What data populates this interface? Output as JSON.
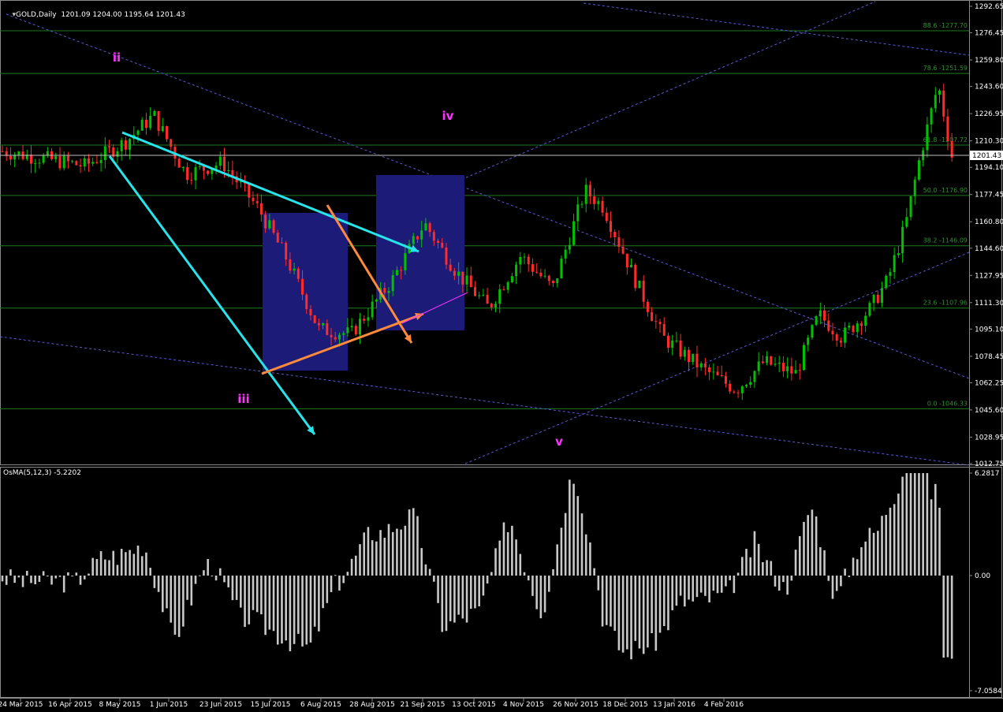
{
  "header": {
    "symbol_line": "GOLD,Daily  1201.09 1204.00 1195.64 1201.43",
    "indicator_line": "OsMA(5,12,3) -5.2202"
  },
  "colors": {
    "bull": "#00c000",
    "bear": "#ff2a2a",
    "fib": "#1f7a1f",
    "fib_text": "#2f8f2f",
    "channel": "#5a5ad8",
    "box": "#1c1c78",
    "cyan": "#27e3ea",
    "orange": "#ff8a3c",
    "wave": "#ff33ff",
    "osma": "#c8c8c8"
  },
  "chart_data": [
    {
      "type": "candlestick",
      "title": "GOLD,Daily",
      "ohlc_readout": {
        "open": 1201.09,
        "high": 1204.0,
        "low": 1195.64,
        "close": 1201.43
      },
      "ylim": [
        1012.75,
        1292.65
      ],
      "y_ticks": [
        "1292.65",
        "1276.45",
        "1259.80",
        "1243.60",
        "1226.95",
        "1210.30",
        "1194.10",
        "1177.45",
        "1160.80",
        "1144.60",
        "1127.95",
        "1111.30",
        "1095.10",
        "1078.45",
        "1062.25",
        "1045.60",
        "1028.95",
        "1012.75"
      ],
      "current_price_label": "1201.43",
      "x_ticks": [
        "24 Mar 2015",
        "16 Apr 2015",
        "8 May 2015",
        "1 Jun 2015",
        "23 Jun 2015",
        "15 Jul 2015",
        "6 Aug 2015",
        "28 Aug 2015",
        "21 Sep 2015",
        "13 Oct 2015",
        "4 Nov 2015",
        "26 Nov 2015",
        "18 Dec 2015",
        "13 Jan 2016",
        "4 Feb 2016"
      ],
      "fib_levels": [
        {
          "label": "88.6 -1277.70",
          "value": 1277.7
        },
        {
          "label": "78.6 -1251.59",
          "value": 1251.59
        },
        {
          "label": "61.8 -1207.72",
          "value": 1207.72
        },
        {
          "label": "50.0 -1176.90",
          "value": 1176.9
        },
        {
          "label": "38.2 -1146.09",
          "value": 1146.09
        },
        {
          "label": "23.6 -1107.96",
          "value": 1107.96
        },
        {
          "label": "0.0 -1046.33",
          "value": 1046.33
        }
      ],
      "wave_labels": [
        {
          "text": "ii"
        },
        {
          "text": "iii"
        },
        {
          "text": "iv"
        },
        {
          "text": "v"
        }
      ],
      "anchors": [
        {
          "x": 0.0,
          "y": 1204
        },
        {
          "x": 0.09,
          "y": 1195
        },
        {
          "x": 0.135,
          "y": 1210
        },
        {
          "x": 0.165,
          "y": 1226
        },
        {
          "x": 0.2,
          "y": 1190
        },
        {
          "x": 0.24,
          "y": 1197
        },
        {
          "x": 0.28,
          "y": 1168
        },
        {
          "x": 0.31,
          "y": 1138
        },
        {
          "x": 0.345,
          "y": 1095
        },
        {
          "x": 0.38,
          "y": 1092
        },
        {
          "x": 0.425,
          "y": 1125
        },
        {
          "x": 0.46,
          "y": 1160
        },
        {
          "x": 0.495,
          "y": 1130
        },
        {
          "x": 0.53,
          "y": 1108
        },
        {
          "x": 0.565,
          "y": 1140
        },
        {
          "x": 0.6,
          "y": 1120
        },
        {
          "x": 0.635,
          "y": 1180
        },
        {
          "x": 0.655,
          "y": 1170
        },
        {
          "x": 0.69,
          "y": 1125
        },
        {
          "x": 0.72,
          "y": 1090
        },
        {
          "x": 0.765,
          "y": 1070
        },
        {
          "x": 0.8,
          "y": 1058
        },
        {
          "x": 0.83,
          "y": 1075
        },
        {
          "x": 0.865,
          "y": 1068
        },
        {
          "x": 0.89,
          "y": 1104
        },
        {
          "x": 0.915,
          "y": 1090
        },
        {
          "x": 0.945,
          "y": 1107
        },
        {
          "x": 0.965,
          "y": 1125
        },
        {
          "x": 0.985,
          "y": 1160
        },
        {
          "x": 1.0,
          "y": 1200
        },
        {
          "x": 1.02,
          "y": 1245
        },
        {
          "x": 1.035,
          "y": 1201
        }
      ]
    },
    {
      "type": "bar",
      "title": "OsMA(5,12,3) -5.2202",
      "ylim": [
        -7.0584,
        6.2817
      ],
      "y_ticks": [
        "6.2817",
        "0.00",
        "-7.0584"
      ],
      "bars_seed_description": ""
    }
  ]
}
